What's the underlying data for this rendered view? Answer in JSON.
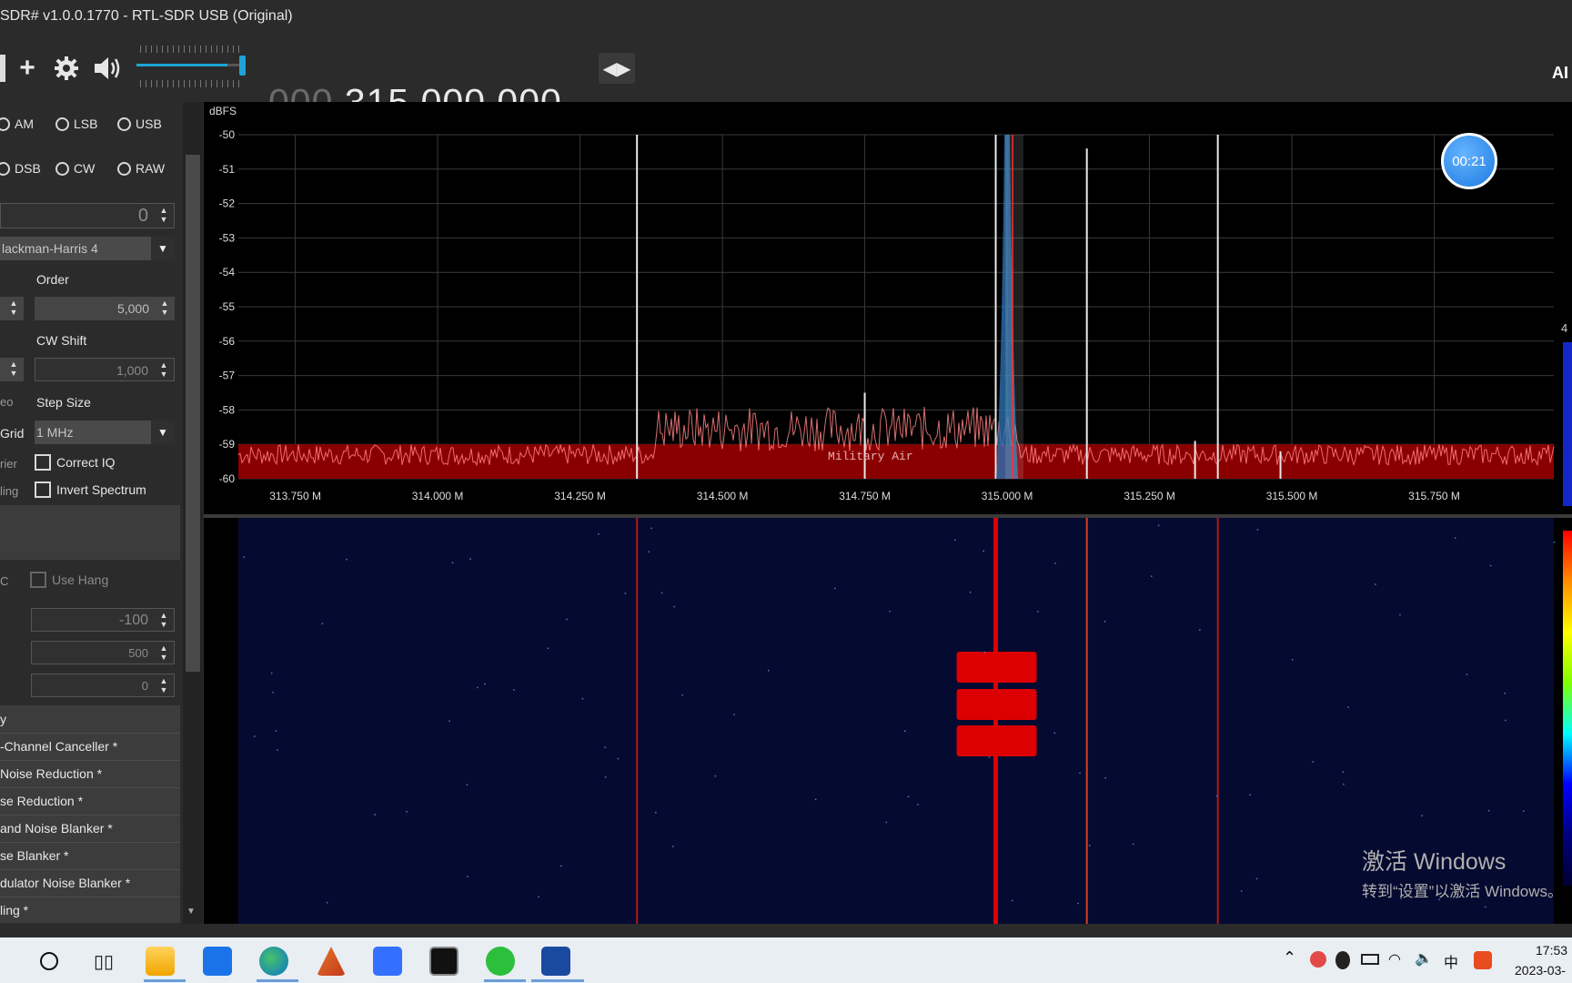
{
  "window": {
    "title": "SDR# v1.0.0.1770 - RTL-SDR USB (Original)"
  },
  "toolbar": {
    "freq_dim": "000.",
    "freq_main": "315.000.000",
    "volume_level": 0.85,
    "brand": "AI"
  },
  "left": {
    "modes": [
      "AM",
      "LSB",
      "USB",
      "DSB",
      "CW",
      "RAW"
    ],
    "shift_value": "0",
    "window_fn": "lackman-Harris 4",
    "order_label": "Order",
    "order_value": "5,000",
    "cwshift_label": "CW Shift",
    "cwshift_value": "1,000",
    "eo_label": "eo",
    "stepsize_label": "Step Size",
    "grid_label": "Grid",
    "step_value": "1 MHz",
    "rier_label": "rier",
    "correct_iq": "Correct IQ",
    "ling_label": "ling",
    "invert_spectrum": "Invert Spectrum",
    "c_label": "C",
    "use_hang": "Use Hang",
    "agc_threshold": "-100",
    "agc_decay": "500",
    "agc_slope": "0",
    "plugin_header": "y",
    "plugins": [
      "-Channel Canceller *",
      "Noise Reduction *",
      "se Reduction *",
      "and Noise Blanker *",
      "se Blanker *",
      "dulator Noise Blanker *",
      "ling *"
    ]
  },
  "spectrum": {
    "unit": "dBFS",
    "y_ticks": [
      "-50",
      "-51",
      "-52",
      "-53",
      "-54",
      "-55",
      "-56",
      "-57",
      "-58",
      "-59",
      "-60"
    ],
    "x_ticks": [
      "313.750 M",
      "314.000 M",
      "314.250 M",
      "314.500 M",
      "314.750 M",
      "315.000 M",
      "315.250 M",
      "315.500 M",
      "315.750 M"
    ],
    "band_label": "Military Air",
    "timer": "00:21",
    "side_value": "4"
  },
  "chart_data": {
    "type": "line",
    "title": "",
    "xlabel": "",
    "ylabel": "dBFS",
    "xlim": [
      313.65,
      315.96
    ],
    "ylim": [
      -60,
      -50
    ],
    "grid": true,
    "peaks": [
      {
        "x": 314.35,
        "y": -50.0
      },
      {
        "x": 314.98,
        "y": -50.0
      },
      {
        "x": 315.14,
        "y": -50.4
      },
      {
        "x": 315.37,
        "y": -50.0
      },
      {
        "x": 314.75,
        "y": -57.5
      },
      {
        "x": 315.33,
        "y": -58.9
      },
      {
        "x": 315.48,
        "y": -59.2
      }
    ]
  },
  "watermark": {
    "line1": "激活 Windows",
    "line2": "转到“设置”以激活 Windows。"
  },
  "taskbar": {
    "time": "17:53",
    "date": "2023-03-",
    "apps": [
      "search",
      "task-view",
      "file-explorer",
      "mail",
      "edge",
      "matlab",
      "feishu",
      "terminal",
      "wechat",
      "sdrsharp"
    ]
  }
}
